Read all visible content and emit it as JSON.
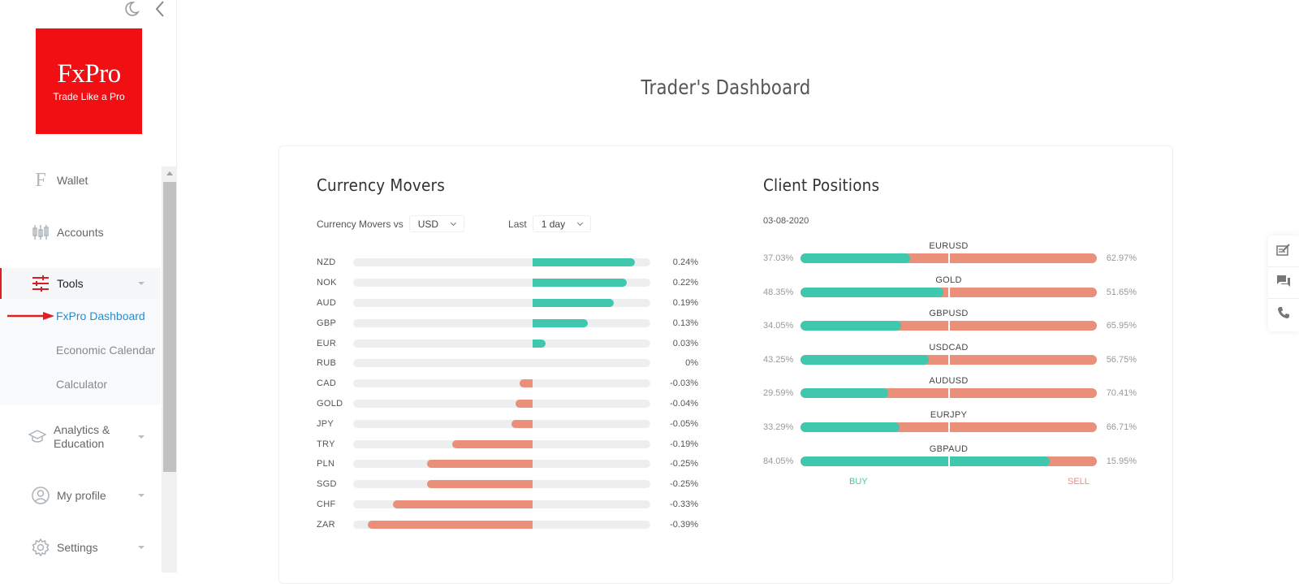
{
  "sidebar": {
    "top_icons": [
      "moon-icon",
      "chevron-left-icon"
    ],
    "logo": {
      "brand": "FxPro",
      "tagline": "Trade Like a Pro",
      "color": "#f20f14"
    },
    "items": [
      {
        "label": "Wallet",
        "icon": "wallet-f-icon"
      },
      {
        "label": "Accounts",
        "icon": "candlestick-icon"
      },
      {
        "label": "Tools",
        "icon": "sliders-icon",
        "expanded": true,
        "children": [
          {
            "label": "FxPro Dashboard",
            "current": true
          },
          {
            "label": "Economic Calendar"
          },
          {
            "label": "Calculator"
          }
        ]
      },
      {
        "label": "Analytics &",
        "label2": "Education",
        "icon": "graduation-cap-icon"
      },
      {
        "label": "My profile",
        "icon": "user-circle-icon"
      },
      {
        "label": "Settings",
        "icon": "gear-icon"
      }
    ]
  },
  "main": {
    "title": "Trader's Dashboard",
    "currency_movers": {
      "title": "Currency Movers",
      "vs_label": "Currency Movers vs",
      "vs_value": "USD",
      "last_label": "Last",
      "last_value": "1 day",
      "rows": [
        {
          "symbol": "NZD",
          "value": 0.24,
          "label": "0.24%"
        },
        {
          "symbol": "NOK",
          "value": 0.22,
          "label": "0.22%"
        },
        {
          "symbol": "AUD",
          "value": 0.19,
          "label": "0.19%"
        },
        {
          "symbol": "GBP",
          "value": 0.13,
          "label": "0.13%"
        },
        {
          "symbol": "EUR",
          "value": 0.03,
          "label": "0.03%"
        },
        {
          "symbol": "RUB",
          "value": 0,
          "label": "0%"
        },
        {
          "symbol": "CAD",
          "value": -0.03,
          "label": "-0.03%"
        },
        {
          "symbol": "GOLD",
          "value": -0.04,
          "label": "-0.04%"
        },
        {
          "symbol": "JPY",
          "value": -0.05,
          "label": "-0.05%"
        },
        {
          "symbol": "TRY",
          "value": -0.19,
          "label": "-0.19%"
        },
        {
          "symbol": "PLN",
          "value": -0.25,
          "label": "-0.25%"
        },
        {
          "symbol": "SGD",
          "value": -0.25,
          "label": "-0.25%"
        },
        {
          "symbol": "CHF",
          "value": -0.33,
          "label": "-0.33%"
        },
        {
          "symbol": "ZAR",
          "value": -0.39,
          "label": "-0.39%"
        }
      ],
      "scale_max": 0.45
    },
    "client_positions": {
      "title": "Client Positions",
      "date": "03-08-2020",
      "rows": [
        {
          "symbol": "EURUSD",
          "buy": 37.03,
          "sell": 62.97,
          "buy_label": "37.03%",
          "sell_label": "62.97%"
        },
        {
          "symbol": "GOLD",
          "buy": 48.35,
          "sell": 51.65,
          "buy_label": "48.35%",
          "sell_label": "51.65%"
        },
        {
          "symbol": "GBPUSD",
          "buy": 34.05,
          "sell": 65.95,
          "buy_label": "34.05%",
          "sell_label": "65.95%"
        },
        {
          "symbol": "USDCAD",
          "buy": 43.25,
          "sell": 56.75,
          "buy_label": "43.25%",
          "sell_label": "56.75%"
        },
        {
          "symbol": "AUDUSD",
          "buy": 29.59,
          "sell": 70.41,
          "buy_label": "29.59%",
          "sell_label": "70.41%"
        },
        {
          "symbol": "EURJPY",
          "buy": 33.29,
          "sell": 66.71,
          "buy_label": "33.29%",
          "sell_label": "66.71%"
        },
        {
          "symbol": "GBPAUD",
          "buy": 84.05,
          "sell": 15.95,
          "buy_label": "84.05%",
          "sell_label": "15.95%"
        }
      ],
      "legend": {
        "buy": "BUY",
        "sell": "SELL"
      }
    },
    "colors": {
      "positive": "#3fc8ad",
      "negative": "#e98f7a",
      "accent_link": "#1f8fd6",
      "brand_red": "#e01e24"
    }
  },
  "widget": {
    "buttons": [
      "feedback-icon",
      "chat-icon",
      "phone-icon"
    ]
  }
}
